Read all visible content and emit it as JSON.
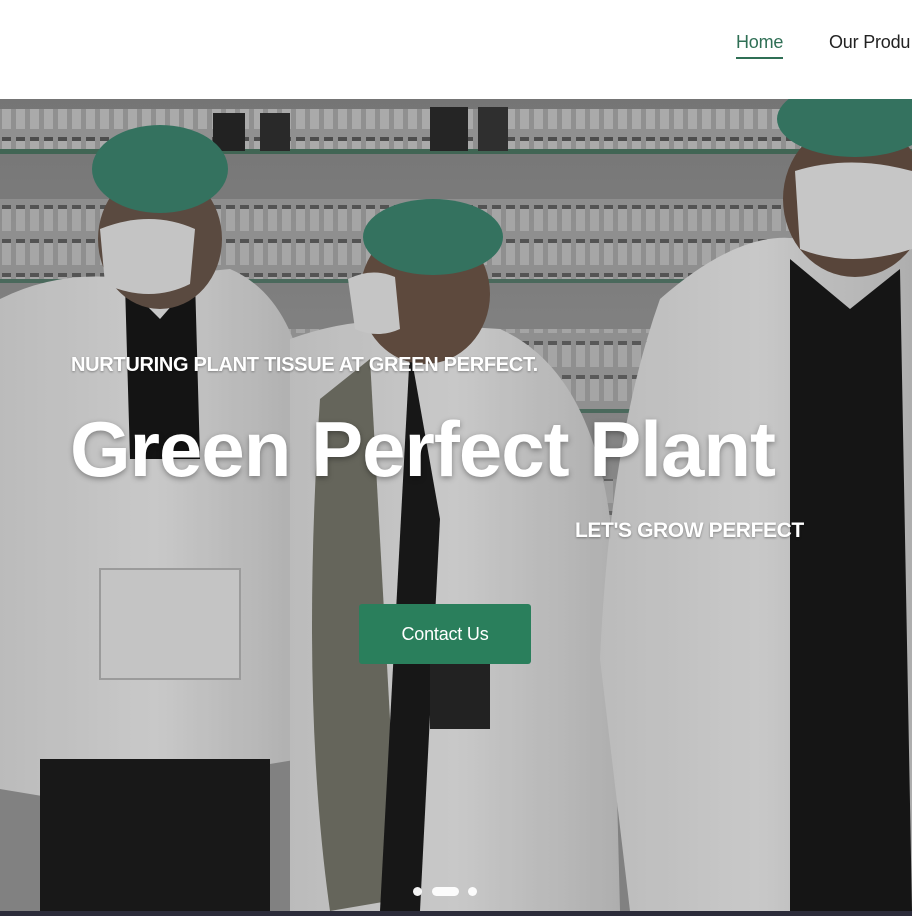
{
  "nav": {
    "items": [
      {
        "label": "Home",
        "active": true
      },
      {
        "label": "Our Produ",
        "active": false
      }
    ]
  },
  "hero": {
    "tagline": "NURTURING PLANT TISSUE AT GREEN PERFECT.",
    "title": "Green Perfect Plant",
    "subtitle": "LET'S GROW PERFECT",
    "cta_label": "Contact Us",
    "slides": {
      "count": 3,
      "active_index": 1
    }
  },
  "colors": {
    "accent": "#2f6f55",
    "cta": "#2a7f5c",
    "text_light": "#ffffff",
    "nav_text": "#222222"
  }
}
